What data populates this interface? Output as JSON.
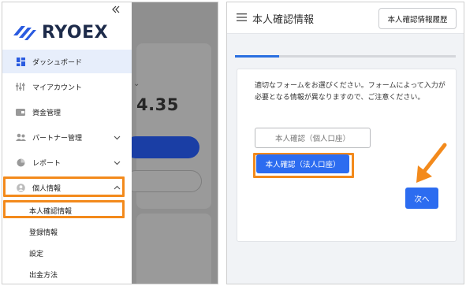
{
  "brand": {
    "name": "RYOEX"
  },
  "sidebar": {
    "items": [
      {
        "label": "ダッシュボード",
        "icon": "dashboard-icon",
        "active": true
      },
      {
        "label": "マイアカウント",
        "icon": "account-icon"
      },
      {
        "label": "資金管理",
        "icon": "wallet-icon"
      },
      {
        "label": "パートナー管理",
        "icon": "partners-icon",
        "expandable": true
      },
      {
        "label": "レポート",
        "icon": "report-icon",
        "expandable": true
      },
      {
        "label": "個人情報",
        "icon": "user-icon",
        "expanded": true,
        "highlighted": true
      }
    ],
    "subitems": [
      {
        "label": "本人確認情報",
        "highlighted": true
      },
      {
        "label": "登録情報"
      },
      {
        "label": "設定"
      },
      {
        "label": "出金方法"
      }
    ]
  },
  "background_page": {
    "value_fragment": "4.35"
  },
  "main": {
    "title": "本人確認情報",
    "history_button": "本人確認情報履歴",
    "progress": 0.2,
    "description": "適切なフォームをお選びください。フォームによって入力が必要となる情報が異なりますので、ご注意ください。",
    "buttons": {
      "personal": "本人確認（個人口座）",
      "corporate": "本人確認（法人口座）",
      "next": "次へ"
    }
  },
  "colors": {
    "accent": "#2c6cf0",
    "highlight": "#f38a1c",
    "active_bg": "#e7eefb",
    "brand_text": "#1d2b4a"
  }
}
